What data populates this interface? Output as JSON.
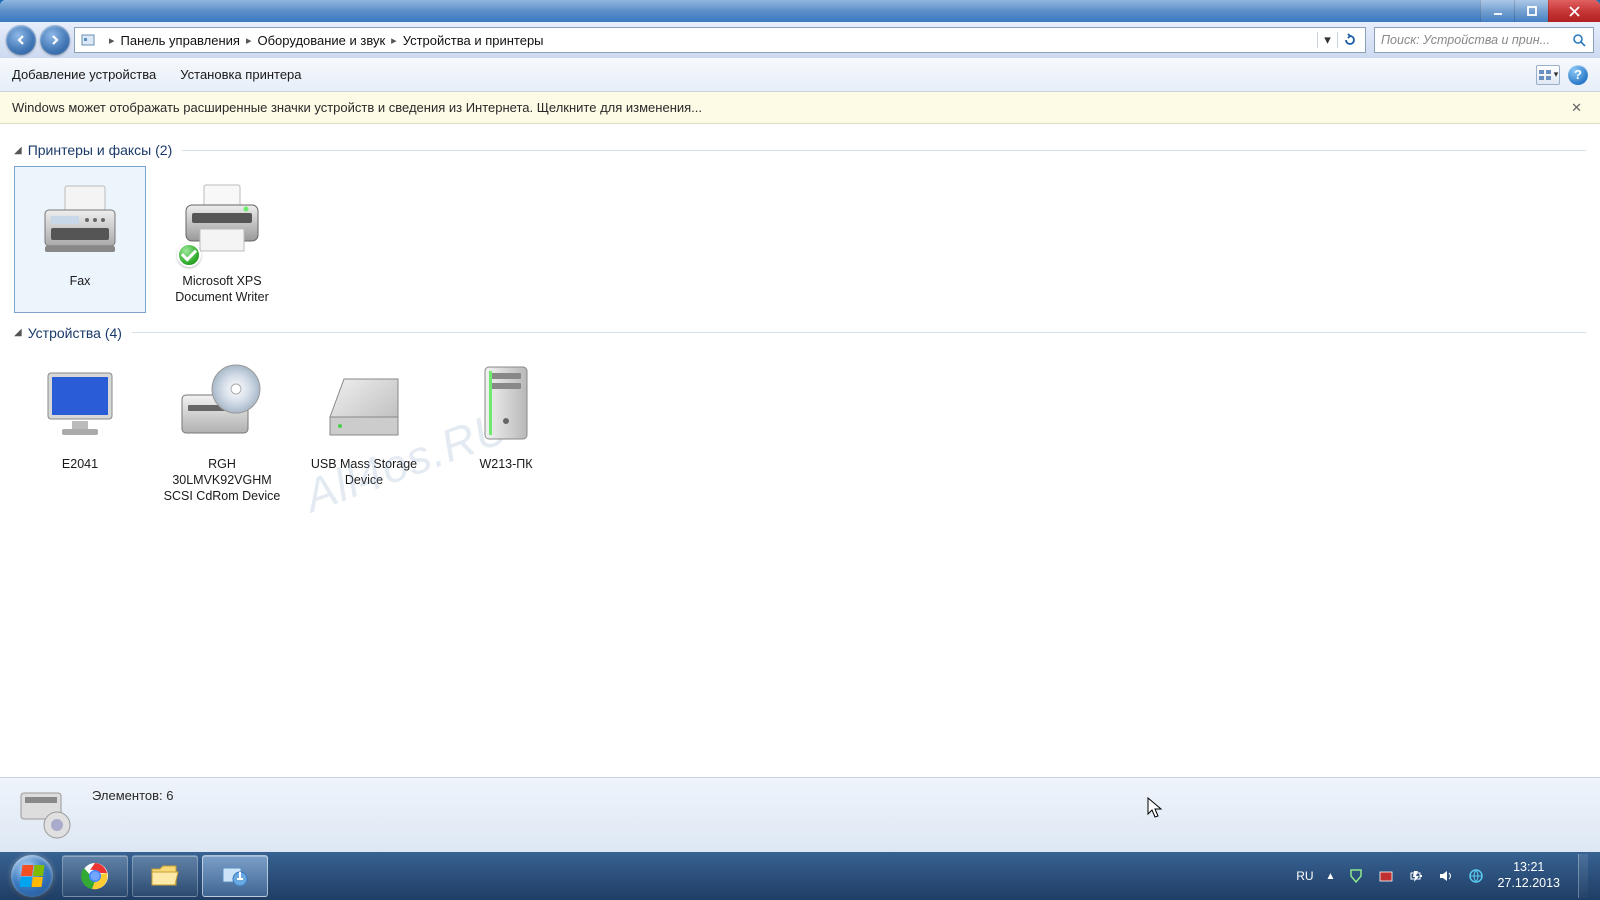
{
  "titlebar": {
    "minimize": "_",
    "maximize": "▢",
    "close": "✕"
  },
  "breadcrumb": {
    "seg1": "Панель управления",
    "seg2": "Оборудование и звук",
    "seg3": "Устройства и принтеры"
  },
  "search": {
    "placeholder": "Поиск: Устройства и прин..."
  },
  "toolbar": {
    "add_device": "Добавление устройства",
    "add_printer": "Установка принтера"
  },
  "infobar": {
    "text": "Windows может отображать расширенные значки устройств и сведения из Интернета.  Щелкните для изменения...",
    "close": "✕"
  },
  "group_printers": {
    "title": "Принтеры и факсы",
    "count": "(2)"
  },
  "group_devices": {
    "title": "Устройства",
    "count": "(4)"
  },
  "items": {
    "fax": "Fax",
    "xps": "Microsoft XPS Document Writer",
    "monitor": "E2041",
    "cdrom": "RGH 30LMVK92VGHM SCSI CdRom Device",
    "usb": "USB Mass Storage Device",
    "pc": "W213-ПК"
  },
  "statusbar": {
    "text": "Элементов: 6"
  },
  "tray": {
    "lang": "RU",
    "chevron": "▲",
    "time": "13:21",
    "date": "27.12.2013"
  },
  "watermark": "All4os.RU"
}
